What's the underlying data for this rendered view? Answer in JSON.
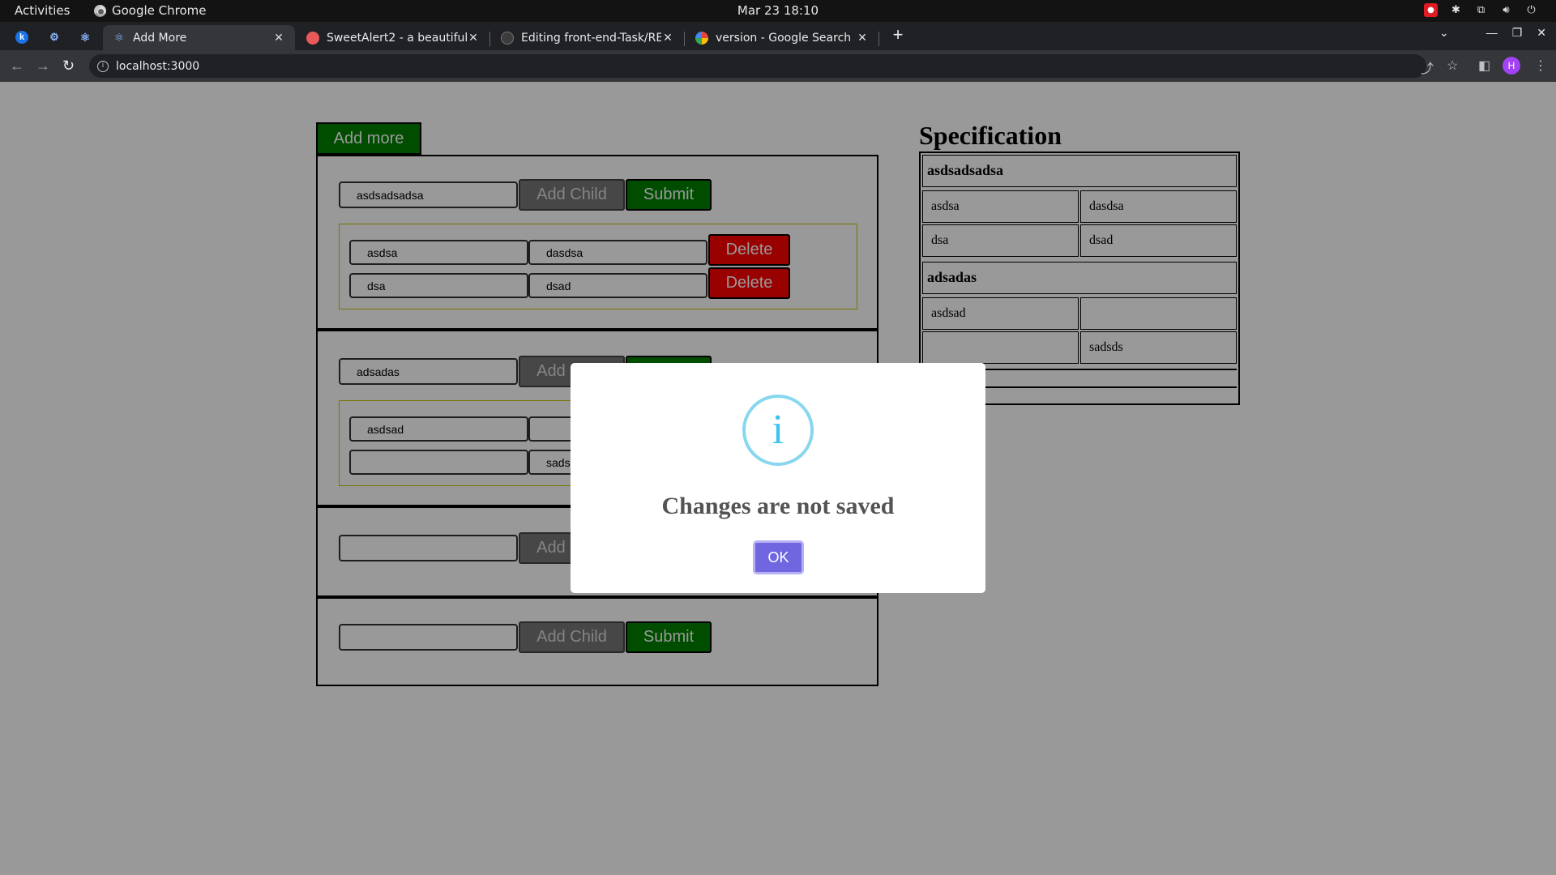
{
  "os": {
    "activities": "Activities",
    "app_name": "Google Chrome",
    "clock": "Mar 23  18:10"
  },
  "browser": {
    "tabs": [
      {
        "title": "Add More",
        "active": true
      },
      {
        "title": "SweetAlert2 - a beautiful,",
        "active": false
      },
      {
        "title": "Editing front-end-Task/RE",
        "active": false
      },
      {
        "title": "version - Google Search",
        "active": false
      }
    ],
    "url": "localhost:3000",
    "profile_initial": "H"
  },
  "page": {
    "add_more_label": "Add more",
    "add_child_label": "Add Child",
    "submit_label": "Submit",
    "delete_label": "Delete",
    "sections": [
      {
        "parent": "asdsadsadsa",
        "children": [
          [
            "asdsa",
            "dasdsa"
          ],
          [
            "dsa",
            "dsad"
          ]
        ]
      },
      {
        "parent": "adsadas",
        "children": [
          [
            "asdsad",
            ""
          ],
          [
            "",
            "sadsds"
          ]
        ]
      },
      {
        "parent": "",
        "children": []
      },
      {
        "parent": "",
        "children": []
      }
    ]
  },
  "spec": {
    "title": "Specification",
    "groups": [
      {
        "name": "asdsadsadsa",
        "rows": [
          [
            "asdsa",
            "dasdsa"
          ],
          [
            "dsa",
            "dsad"
          ]
        ]
      },
      {
        "name": "adsadas",
        "rows": [
          [
            "asdsad",
            ""
          ],
          [
            "",
            "sadsds"
          ]
        ]
      }
    ]
  },
  "dialog": {
    "icon": "i",
    "title": "Changes are not saved",
    "ok_label": "OK",
    "icon_color": "#3fc3ee",
    "button_color": "#7066e0"
  }
}
